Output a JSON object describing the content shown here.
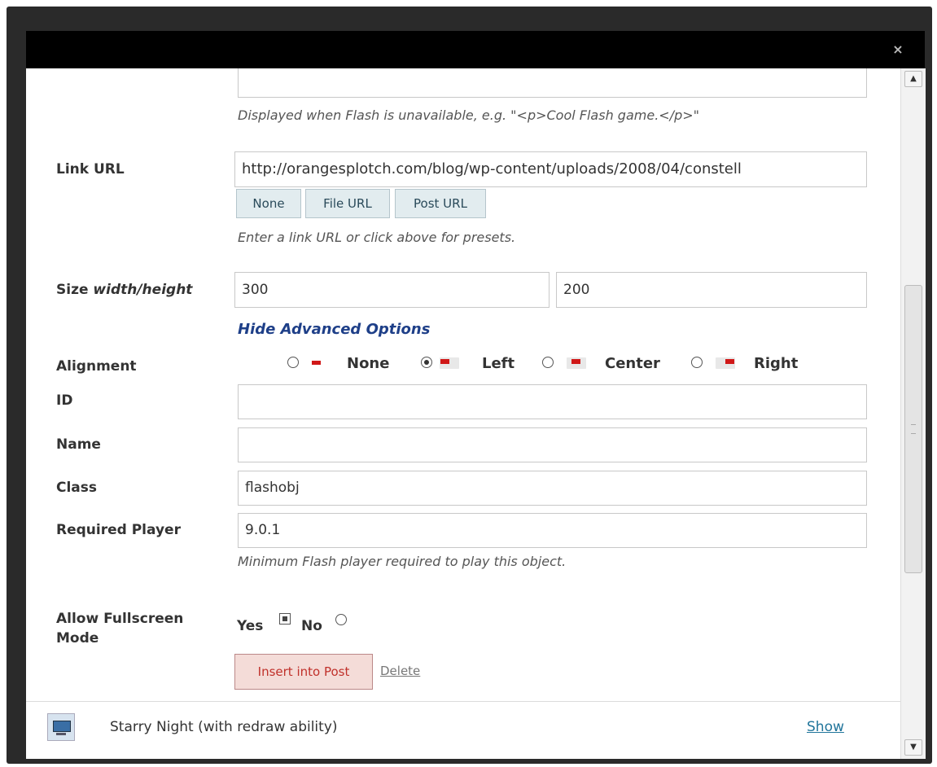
{
  "dialog": {
    "close_label": "×"
  },
  "fields": {
    "alt_hint": "Displayed when Flash is unavailable, e.g. \"<p>Cool Flash game.</p>\"",
    "link_url": {
      "label": "Link URL",
      "value": "http://orangesplotch.com/blog/wp-content/uploads/2008/04/constell",
      "buttons": [
        "None",
        "File URL",
        "Post URL"
      ],
      "hint": "Enter a link URL or click above for presets."
    },
    "size": {
      "label_prefix": "Size ",
      "label_italic": "width/height",
      "width": "300",
      "height": "200"
    },
    "advanced_toggle": "Hide Advanced Options",
    "alignment": {
      "label": "Alignment",
      "options": [
        "None",
        "Left",
        "Center",
        "Right"
      ],
      "selected": "Left"
    },
    "id": {
      "label": "ID",
      "value": ""
    },
    "name": {
      "label": "Name",
      "value": ""
    },
    "class": {
      "label": "Class",
      "value": "flashobj"
    },
    "player": {
      "label": "Required Player",
      "value": "9.0.1",
      "hint": "Minimum Flash player required to play this object."
    },
    "fullscreen": {
      "label_line1": "Allow Fullscreen",
      "label_line2": "Mode",
      "yes": "Yes",
      "no": "No",
      "selected": "Yes"
    }
  },
  "actions": {
    "insert": "Insert into Post",
    "delete": "Delete"
  },
  "media_item": {
    "title": "Starry Night (with redraw ability)",
    "show": "Show"
  },
  "colors": {
    "accent": "#21759b",
    "advanced_link": "#1e3f88",
    "insert_text": "#c0302a",
    "align_marker": "#d01818"
  }
}
